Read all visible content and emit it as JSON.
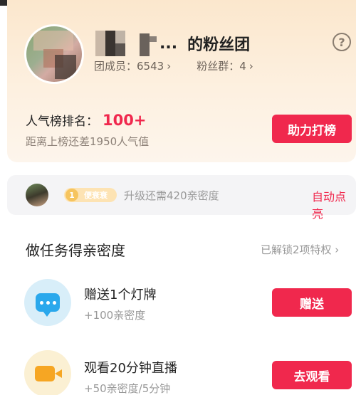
{
  "club": {
    "name_suffix": "的粉丝团",
    "ellipsis": "...",
    "members_label": "团成员：6543",
    "groups_label": "粉丝群：4",
    "chevron": "›"
  },
  "help_icon": "?",
  "rank": {
    "label": "人气榜排名：",
    "value": "100+",
    "gap_text": "距离上榜还差1950人气值",
    "boost_button": "助力打榜"
  },
  "level": {
    "badge_number": "1",
    "badge_name": "便衰衰",
    "progress_text": "升级还需420亲密度",
    "auto_light_link": "自动点亮"
  },
  "tasks_section": {
    "title": "做任务得亲密度",
    "unlock_link": "已解锁2项特权 ›",
    "tasks": [
      {
        "title": "赠送1个灯牌",
        "reward": "+100亲密度",
        "button": "赠送",
        "icon": "message-icon"
      },
      {
        "title": "观看20分钟直播",
        "reward": "+50亲密度/5分钟",
        "button": "去观看",
        "icon": "video-icon"
      }
    ]
  },
  "colors": {
    "accent": "#f0284d",
    "header_bg": "#fbe7cd",
    "level_bg": "#f4f4f6"
  }
}
